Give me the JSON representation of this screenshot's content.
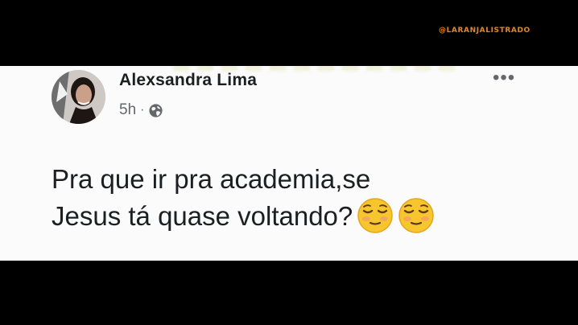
{
  "watermark": "@LARANJALISTRADO",
  "post": {
    "author": "Alexsandra Lima",
    "time": "5h",
    "separator": "·",
    "privacy_icon": "globe-icon",
    "more_icon": "more-options-icon",
    "more_label": "•••",
    "text_lines": [
      "Pra que ir pra academia,se",
      "Jesus tá quase voltando?"
    ],
    "emojis": [
      "relieved-face-emoji",
      "relieved-face-emoji"
    ]
  },
  "colors": {
    "background": "#000000",
    "card": "#fbfbfb",
    "text_primary": "#1c1e21",
    "text_secondary": "#65676b",
    "watermark": "#e0872c",
    "emoji_yellow": "#f7c62f"
  }
}
